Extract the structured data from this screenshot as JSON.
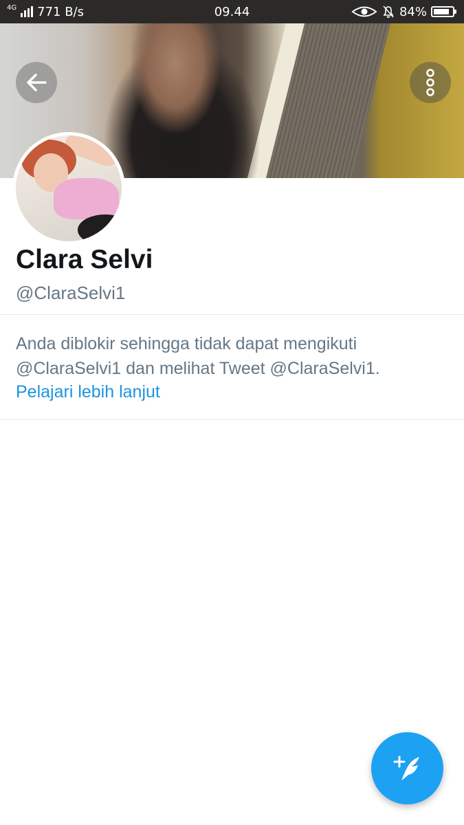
{
  "status_bar": {
    "network_type": "4G",
    "speed": "771 B/s",
    "time": "09.44",
    "battery": "84%",
    "battery_level": 0.84
  },
  "header": {
    "back_icon": "arrow-left-icon",
    "more_icon": "vertical-dots-icon"
  },
  "profile": {
    "name": "Clara Selvi",
    "handle": "@ClaraSelvi1"
  },
  "blocked": {
    "line1": "Anda diblokir sehingga tidak dapat mengikuti",
    "line2": "@ClaraSelvi1 dan melihat Tweet @ClaraSelvi1.",
    "learn_more": "Pelajari lebih lanjut"
  },
  "fab": {
    "icon": "compose-tweet-icon"
  },
  "colors": {
    "accent": "#1da1f2",
    "link": "#1b95e0",
    "secondary_text": "#657786",
    "primary_text": "#14171a"
  }
}
